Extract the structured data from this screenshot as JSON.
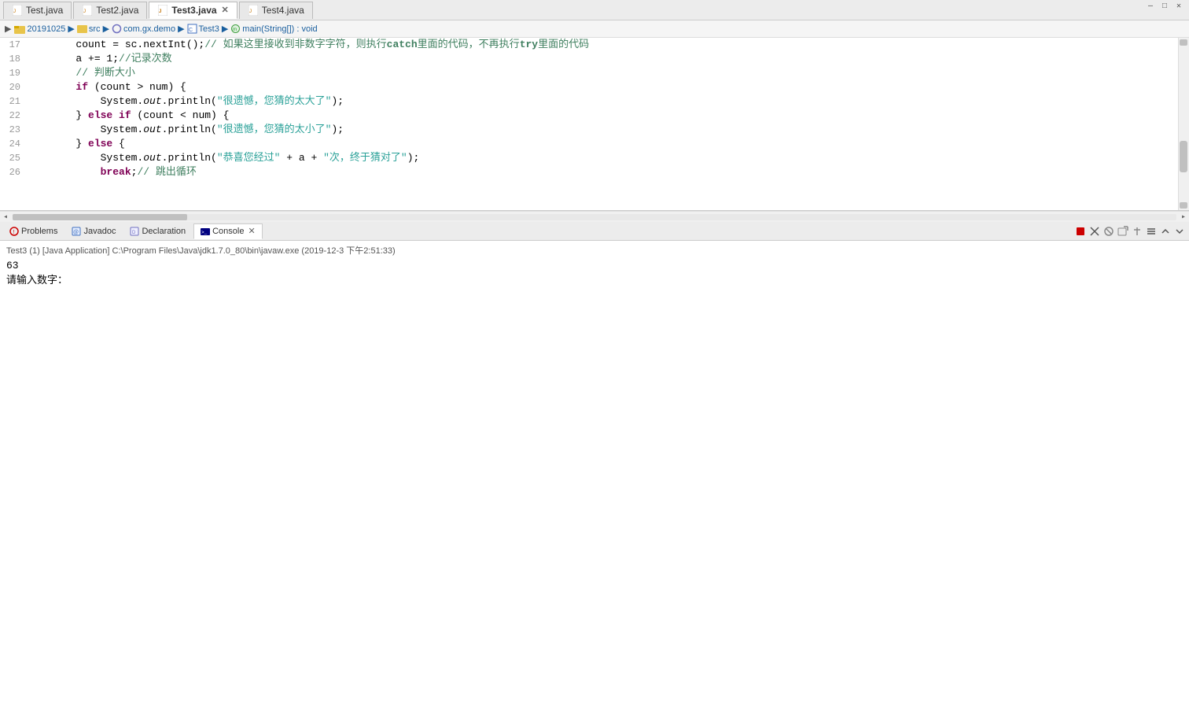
{
  "window": {
    "controls": [
      "—",
      "□",
      "✕"
    ]
  },
  "tabs": [
    {
      "id": "test1",
      "label": "Test.java",
      "icon": "java-icon",
      "active": false,
      "closable": false
    },
    {
      "id": "test2",
      "label": "Test2.java",
      "icon": "java-icon",
      "active": false,
      "closable": false
    },
    {
      "id": "test3",
      "label": "Test3.java",
      "icon": "java-icon",
      "active": true,
      "closable": true
    },
    {
      "id": "test4",
      "label": "Test4.java",
      "icon": "java-icon",
      "active": false,
      "closable": false
    }
  ],
  "breadcrumb": {
    "items": [
      "20191025",
      "src",
      "com.gx.demo",
      "Test3",
      "main(String[]) : void"
    ]
  },
  "code": {
    "lines": [
      {
        "num": "17",
        "content": "        count = sc.nextInt();// 如果这里接收到非数字字符，则执行catch里面的代码，不再执行try里面的代码"
      },
      {
        "num": "18",
        "content": "        a += 1;//记录次数"
      },
      {
        "num": "19",
        "content": "        // 判断大小"
      },
      {
        "num": "20",
        "content": "        if (count > num) {"
      },
      {
        "num": "21",
        "content": "            System.out.println(\"很遗憾，您猜的太大了\");"
      },
      {
        "num": "22",
        "content": "        } else if (count < num) {"
      },
      {
        "num": "23",
        "content": "            System.out.println(\"很遗憾，您猜的太小了\");"
      },
      {
        "num": "24",
        "content": "        } else {"
      },
      {
        "num": "25",
        "content": "            System.out.println(\"恭喜您经过\" + a + \"次，终于猜对了\");"
      },
      {
        "num": "26",
        "content": "            break;// 跳出循环"
      }
    ]
  },
  "bottom_tabs": [
    {
      "id": "problems",
      "label": "Problems",
      "icon": "problems-icon",
      "active": false
    },
    {
      "id": "javadoc",
      "label": "Javadoc",
      "icon": "javadoc-icon",
      "active": false
    },
    {
      "id": "declaration",
      "label": "Declaration",
      "icon": "declaration-icon",
      "active": false
    },
    {
      "id": "console",
      "label": "Console",
      "icon": "console-icon",
      "active": true,
      "closable": true
    }
  ],
  "console": {
    "status": "Test3 (1) [Java Application] C:\\Program Files\\Java\\jdk1.7.0_80\\bin\\javaw.exe (2019-12-3 下午2:51:33)",
    "output_line1": "63",
    "output_line2": "请输入数字："
  },
  "toolbar_buttons": [
    {
      "id": "stop",
      "icon": "stop-icon",
      "label": "■"
    },
    {
      "id": "close",
      "icon": "close-icon",
      "label": "✕"
    },
    {
      "id": "terminate",
      "icon": "terminate-icon",
      "label": "⊗"
    },
    {
      "id": "new-console",
      "icon": "new-console-icon",
      "label": "⊞"
    },
    {
      "id": "pin",
      "icon": "pin-icon",
      "label": "📌"
    },
    {
      "id": "view-menu",
      "icon": "view-menu-icon",
      "label": "▾"
    },
    {
      "id": "minimize",
      "icon": "minimize-panel-icon",
      "label": "⌃"
    },
    {
      "id": "maximize",
      "icon": "maximize-panel-icon",
      "label": "⌄"
    }
  ]
}
